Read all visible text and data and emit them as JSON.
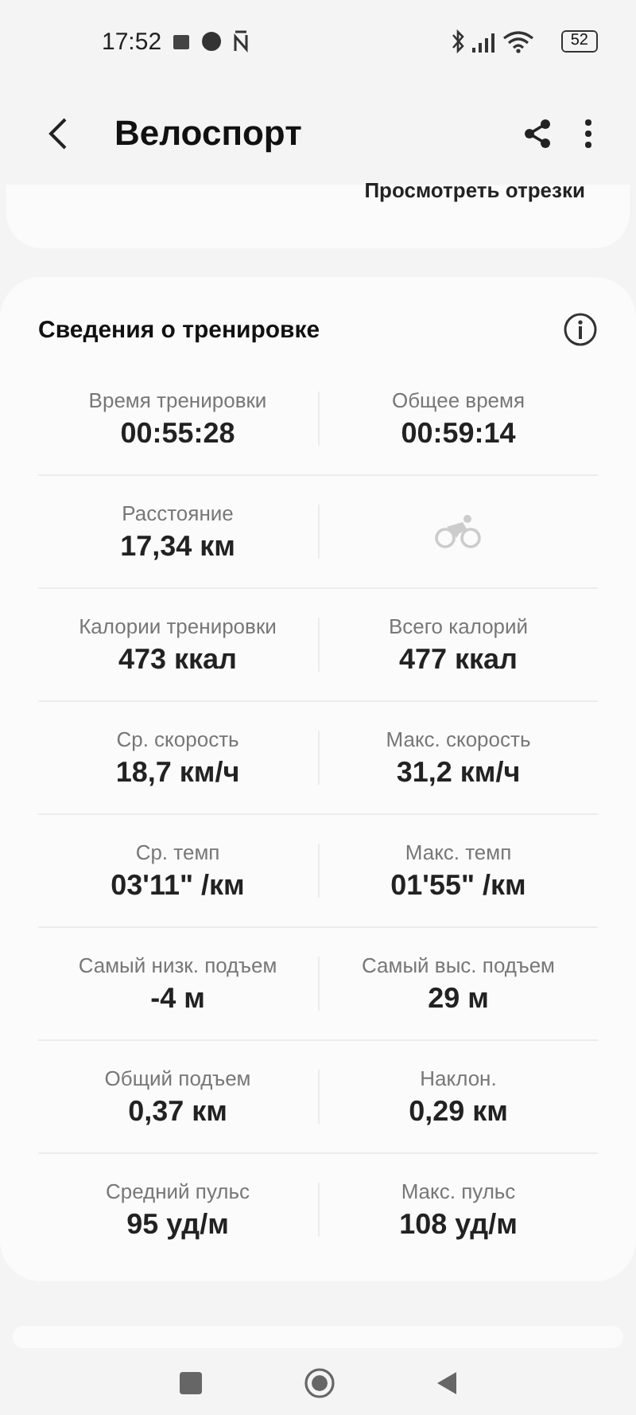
{
  "status_bar": {
    "time": "17:52",
    "battery": "52"
  },
  "header": {
    "title": "Велоспорт"
  },
  "segments_card": {
    "link": "Просмотреть отрезки"
  },
  "workout_card": {
    "title": "Сведения о тренировке",
    "rows": [
      {
        "cells": [
          {
            "kind": "stat",
            "label": "Время тренировки",
            "value": "00:55:28"
          },
          {
            "kind": "stat",
            "label": "Общее время",
            "value": "00:59:14"
          }
        ]
      },
      {
        "cells": [
          {
            "kind": "stat",
            "label": "Расстояние",
            "value": "17,34 км"
          },
          {
            "kind": "icon"
          }
        ]
      },
      {
        "cells": [
          {
            "kind": "stat",
            "label": "Калории тренировки",
            "value": "473 ккал"
          },
          {
            "kind": "stat",
            "label": "Всего калорий",
            "value": "477 ккал"
          }
        ]
      },
      {
        "cells": [
          {
            "kind": "stat",
            "label": "Ср. скорость",
            "value": "18,7 км/ч"
          },
          {
            "kind": "stat",
            "label": "Макс. скорость",
            "value": "31,2 км/ч"
          }
        ]
      },
      {
        "cells": [
          {
            "kind": "stat",
            "label": "Ср. темп",
            "value": "03'11\" /км"
          },
          {
            "kind": "stat",
            "label": "Макс. темп",
            "value": "01'55\" /км"
          }
        ]
      },
      {
        "cells": [
          {
            "kind": "stat",
            "label": "Самый низк. подъем",
            "value": "-4 м"
          },
          {
            "kind": "stat",
            "label": "Самый выс. подъем",
            "value": "29 м"
          }
        ]
      },
      {
        "cells": [
          {
            "kind": "stat",
            "label": "Общий подъем",
            "value": "0,37 км"
          },
          {
            "kind": "stat",
            "label": "Наклон.",
            "value": "0,29 км"
          }
        ]
      },
      {
        "cells": [
          {
            "kind": "stat",
            "label": "Средний пульс",
            "value": "95 уд/м"
          },
          {
            "kind": "stat",
            "label": "Макс. пульс",
            "value": "108 уд/м"
          }
        ]
      }
    ]
  }
}
